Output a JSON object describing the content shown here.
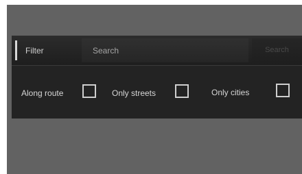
{
  "filter_bar": {
    "label": "Filter",
    "search_placeholder": "Search",
    "search_value": "",
    "search_button": "Search"
  },
  "options": [
    {
      "label": "Along route",
      "checked": false
    },
    {
      "label": "Only streets",
      "checked": false
    },
    {
      "label": "Only cities",
      "checked": false
    }
  ],
  "colors": {
    "background": "#626262",
    "panel": "#232323",
    "accent": "#d9d9d9"
  }
}
